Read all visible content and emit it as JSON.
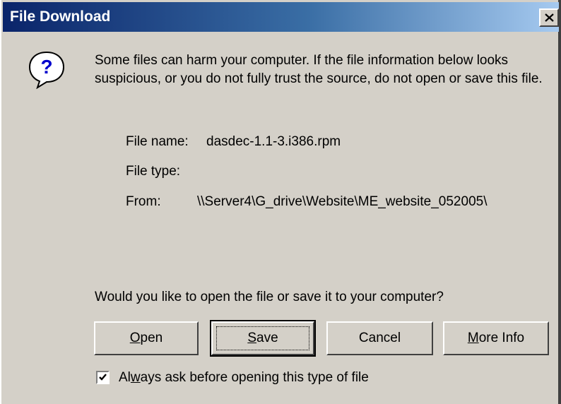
{
  "window": {
    "title": "File Download",
    "close_icon": "close-icon"
  },
  "dialog": {
    "icon": "question-icon",
    "warning": "Some files can harm your computer. If the file information below looks suspicious, or you do not fully trust the source, do not open or save this file.",
    "file_info": {
      "name_label": "File name:",
      "name_value": "dasdec-1.1-3.i386.rpm",
      "type_label": "File type:",
      "type_value": "",
      "from_label": "From:",
      "from_value": "\\\\Server4\\G_drive\\Website\\ME_website_052005\\"
    },
    "question": "Would you like to open the file or save it to your computer?",
    "buttons": {
      "open": {
        "mnemonic": "O",
        "rest": "pen"
      },
      "save": {
        "mnemonic": "S",
        "rest": "ave"
      },
      "cancel": "Cancel",
      "more_info": {
        "mnemonic": "M",
        "rest": "ore Info"
      }
    },
    "checkbox": {
      "checked": true,
      "label_pre": "Al",
      "label_mnemonic": "w",
      "label_post": "ays ask before opening this type of file"
    }
  }
}
